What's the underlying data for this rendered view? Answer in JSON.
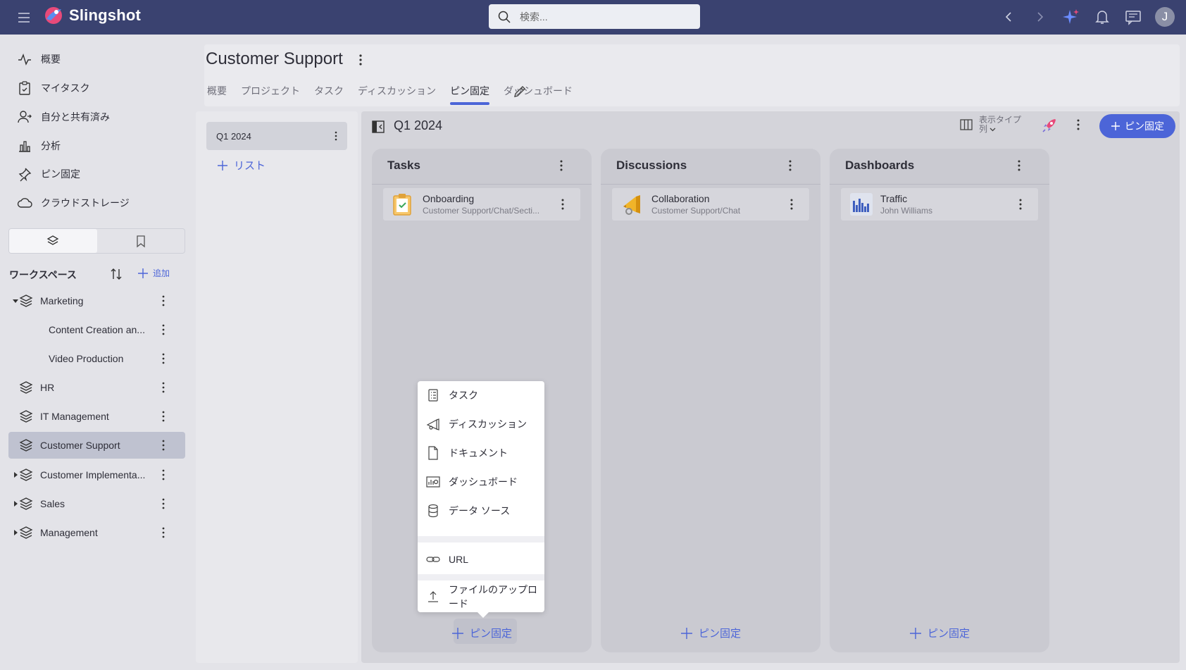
{
  "app": {
    "name": "Slingshot",
    "user_initial": "J"
  },
  "search": {
    "placeholder": "検索..."
  },
  "sidebar": {
    "nav": [
      {
        "label": "概要",
        "icon": "activity-icon"
      },
      {
        "label": "マイタスク",
        "icon": "clipboard-check-icon"
      },
      {
        "label": "自分と共有済み",
        "icon": "shared-user-icon"
      },
      {
        "label": "分析",
        "icon": "bar-chart-icon"
      },
      {
        "label": "ピン固定",
        "icon": "pin-icon"
      },
      {
        "label": "クラウドストレージ",
        "icon": "cloud-icon"
      }
    ],
    "workspace_title": "ワークスペース",
    "add_label": "追加",
    "workspaces": [
      {
        "label": "Marketing",
        "expanded": true
      },
      {
        "label": "Content Creation an...",
        "child": true
      },
      {
        "label": "Video Production",
        "child": true
      },
      {
        "label": "HR"
      },
      {
        "label": "IT Management"
      },
      {
        "label": "Customer Support",
        "selected": true
      },
      {
        "label": "Customer Implementa..."
      },
      {
        "label": "Sales"
      },
      {
        "label": "Management"
      }
    ]
  },
  "page": {
    "title": "Customer Support",
    "tabs": [
      "概要",
      "プロジェクト",
      "タスク",
      "ディスカッション",
      "ピン固定",
      "ダッシュボード"
    ],
    "active_tab": "ピン固定"
  },
  "lists": {
    "items": [
      {
        "label": "Q1 2024"
      }
    ],
    "add_label": "リスト"
  },
  "board": {
    "title": "Q1 2024",
    "view_type_label": "表示タイプ",
    "view_type_value": "列",
    "pin_button": "ピン固定",
    "columns": [
      {
        "title": "Tasks",
        "add_label": "ピン固定",
        "cards": [
          {
            "title": "Onboarding",
            "subtitle": "Customer Support/Chat/Secti...",
            "icon": "task-list-icon"
          }
        ]
      },
      {
        "title": "Discussions",
        "add_label": "ピン固定",
        "cards": [
          {
            "title": "Collaboration",
            "subtitle": "Customer Support/Chat",
            "icon": "megaphone-icon"
          }
        ]
      },
      {
        "title": "Dashboards",
        "add_label": "ピン固定",
        "cards": [
          {
            "title": "Traffic",
            "subtitle": "John Williams",
            "icon": "bar-chart-icon"
          }
        ]
      }
    ]
  },
  "popup_menu": {
    "items": [
      {
        "label": "タスク",
        "icon": "task-list-icon"
      },
      {
        "label": "ディスカッション",
        "icon": "megaphone-icon"
      },
      {
        "label": "ドキュメント",
        "icon": "document-icon"
      },
      {
        "label": "ダッシュボード",
        "icon": "dashboard-icon"
      },
      {
        "label": "データ ソース",
        "icon": "database-icon"
      },
      {
        "label": "URL",
        "icon": "link-icon"
      },
      {
        "label": "ファイルのアップロード",
        "icon": "upload-icon"
      }
    ]
  },
  "colors": {
    "topbar": "#3a4270",
    "accent": "#4c65d8",
    "selected_workspace": "#bfc2d0"
  }
}
